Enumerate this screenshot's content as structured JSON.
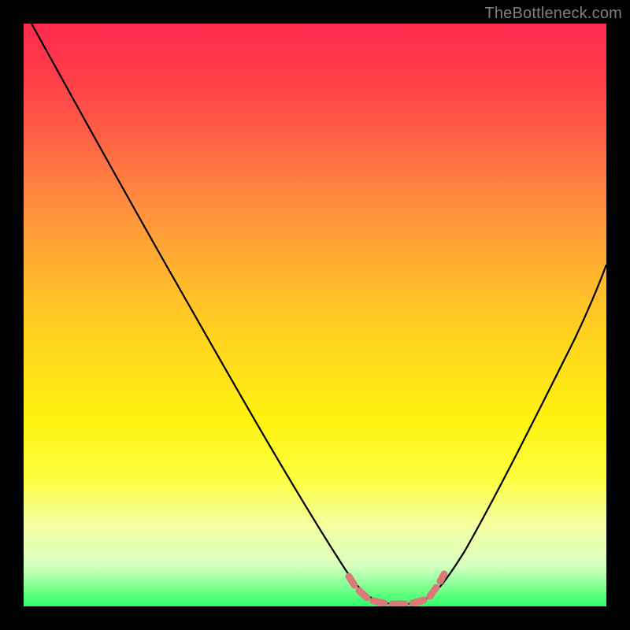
{
  "watermark": "TheBottleneck.com",
  "chart_data": {
    "type": "line",
    "title": "",
    "xlabel": "",
    "ylabel": "",
    "xlim": [
      0,
      100
    ],
    "ylim": [
      0,
      100
    ],
    "x": [
      0,
      5,
      10,
      15,
      20,
      25,
      30,
      35,
      40,
      45,
      50,
      55,
      58,
      60,
      62,
      64,
      66,
      70,
      75,
      80,
      85,
      90,
      95,
      100
    ],
    "y": [
      100,
      92,
      83,
      75,
      67,
      58,
      50,
      42,
      33,
      24,
      15,
      7,
      3,
      1,
      0,
      0,
      0,
      1,
      5,
      12,
      21,
      31,
      41,
      52
    ],
    "series": [
      {
        "name": "bottleneck-curve",
        "color": "#000000"
      }
    ],
    "annotations": [
      {
        "name": "optimal-range-marker",
        "color": "#d87a7a",
        "style": "dashed",
        "x": [
          56,
          58,
          60,
          62,
          64,
          66,
          68,
          70
        ],
        "y": [
          4,
          2,
          1,
          0.5,
          0.5,
          0.5,
          1,
          3
        ]
      }
    ],
    "background_gradient": [
      "#ff2a4d",
      "#ffd61e",
      "#2eff66"
    ]
  }
}
